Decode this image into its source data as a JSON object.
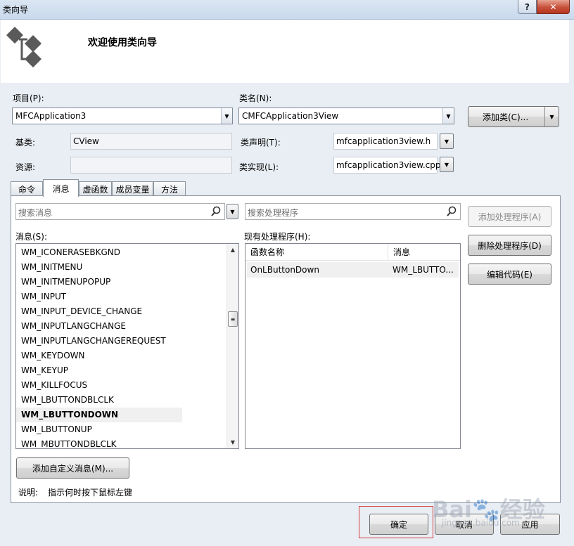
{
  "window": {
    "title": "类向导",
    "help_glyph": "?",
    "close_glyph": "✕"
  },
  "header": {
    "welcome": "欢迎使用类向导"
  },
  "form": {
    "project_label": "项目(P):",
    "project_value": "MFCApplication3",
    "classname_label": "类名(N):",
    "classname_value": "CMFCApplication3View",
    "add_class_label": "添加类(C)...",
    "base_label": "基类:",
    "base_value": "CView",
    "decl_label": "类声明(T):",
    "decl_value": "mfcapplication3view.h",
    "resource_label": "资源:",
    "resource_value": "",
    "impl_label": "类实现(L):",
    "impl_value": "mfcapplication3view.cpp"
  },
  "tabs": [
    "命令",
    "消息",
    "虚函数",
    "成员变量",
    "方法"
  ],
  "active_tab": "消息",
  "messages": {
    "search_placeholder": "搜索消息",
    "list_label": "消息(S):",
    "items": [
      "WM_ICONERASEBKGND",
      "WM_INITMENU",
      "WM_INITMENUPOPUP",
      "WM_INPUT",
      "WM_INPUT_DEVICE_CHANGE",
      "WM_INPUTLANGCHANGE",
      "WM_INPUTLANGCHANGEREQUEST",
      "WM_KEYDOWN",
      "WM_KEYUP",
      "WM_KILLFOCUS",
      "WM_LBUTTONDBLCLK",
      "WM_LBUTTONDOWN",
      "WM_LBUTTONUP",
      "WM_MBUTTONDBLCLK"
    ],
    "selected": "WM_LBUTTONDOWN"
  },
  "handlers": {
    "search_placeholder": "搜索处理程序",
    "list_label": "现有处理程序(H):",
    "col_function": "函数名称",
    "col_message": "消息",
    "rows": [
      {
        "function": "OnLButtonDown",
        "message": "WM_LBUTTO..."
      }
    ]
  },
  "side_buttons": {
    "add_handler": "添加处理程序(A)",
    "delete_handler": "删除处理程序(D)",
    "edit_code": "编辑代码(E)"
  },
  "add_custom_message": "添加自定义消息(M)...",
  "description": {
    "label": "说明:",
    "text": "指示何时按下鼠标左键"
  },
  "footer": {
    "ok": "确定",
    "cancel": "取消",
    "apply": "应用"
  },
  "watermark": {
    "main": "Bai🐾经验",
    "sub": "jingyan.baidu.com"
  },
  "colors": {
    "accent_highlight": "#d23c3c",
    "header_bg": "#ffffff",
    "window_bg": "#e9eef4"
  }
}
